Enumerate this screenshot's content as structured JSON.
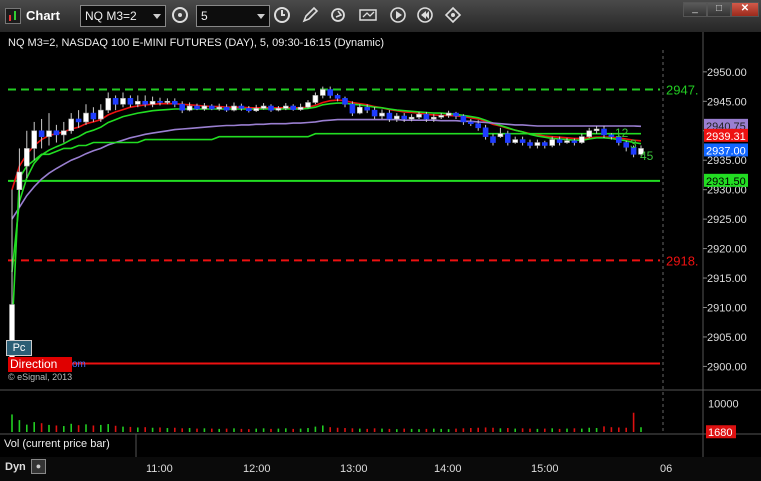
{
  "window": {
    "title": "Chart"
  },
  "toolbar": {
    "symbol": "NQ M3=2",
    "interval": "5",
    "icons": [
      "clock-icon",
      "clock-icon",
      "pencil-icon",
      "refresh-icon",
      "chart-style-icon",
      "play-icon",
      "rewind-icon",
      "cursor-icon"
    ]
  },
  "window_controls": {
    "minimize": "_",
    "maximize": "□",
    "close": "✕"
  },
  "chart_title": "NQ M3=2, NASDAQ 100 E-MINI FUTURES (DAY), 5, 09:30-16:15 (Dynamic)",
  "watermark": "© eSignal, 2013",
  "pc_label": "Pc",
  "direction_label": "Direction",
  "direction_extra": "om",
  "vol_label": "Vol (current price bar)",
  "bottom": {
    "dyn": "Dyn",
    "dyn_icon": "lock-icon"
  },
  "price_boxes": [
    {
      "label": "2947.",
      "color": "#22cc22"
    },
    {
      "label": "2940.75",
      "color": "#9a7fd1"
    },
    {
      "label": "2939.31",
      "color": "#ee1111"
    },
    {
      "label": "2937.00",
      "color": "#1166ff"
    },
    {
      "label": "2931.50",
      "color": "#22dd22"
    },
    {
      "label": "2918.",
      "color": "#ee1111"
    },
    {
      "label": "1680",
      "color": "#dd1111"
    }
  ],
  "counts": [
    "12",
    "3",
    "45"
  ],
  "chart_data": {
    "type": "candlestick",
    "x_ticks": [
      "11:00",
      "12:00",
      "13:00",
      "14:00",
      "15:00",
      "06"
    ],
    "y_ticks": [
      "2950.00",
      "2945.00",
      "2940.00",
      "2935.00",
      "2930.00",
      "2925.00",
      "2920.00",
      "2915.00",
      "2910.00",
      "2905.00",
      "2900.00"
    ],
    "ylim": [
      2898.2,
      2953.2
    ],
    "volume_ticks": [
      "10000"
    ],
    "volume_ylim": [
      0,
      12000
    ],
    "horizontal_lines": [
      {
        "price": 2947.0,
        "color": "#22cc22",
        "style": "dashed"
      },
      {
        "price": 2931.5,
        "color": "#22dd22",
        "style": "solid"
      },
      {
        "price": 2918.0,
        "color": "#ee1111",
        "style": "dashed"
      },
      {
        "price": 2900.5,
        "color": "#ee1111",
        "style": "solid"
      }
    ],
    "candles": [
      [
        2900,
        2910.5,
        2900,
        2930
      ],
      [
        2930,
        2933,
        2927,
        2937
      ],
      [
        2934,
        2937,
        2932,
        2940
      ],
      [
        2937,
        2940,
        2935,
        2941.5
      ],
      [
        2940,
        2939,
        2937,
        2942
      ],
      [
        2939,
        2940,
        2937.5,
        2943
      ],
      [
        2940,
        2939.3,
        2938,
        2941
      ],
      [
        2939.3,
        2940,
        2938,
        2941.5
      ],
      [
        2940,
        2942,
        2939.5,
        2943
      ],
      [
        2942,
        2941.5,
        2940.5,
        2943.5
      ],
      [
        2941.5,
        2943,
        2941,
        2944.5
      ],
      [
        2943,
        2942,
        2941.5,
        2944
      ],
      [
        2942,
        2943.5,
        2941.5,
        2944.5
      ],
      [
        2943.5,
        2945.5,
        2943,
        2946.5
      ],
      [
        2945.5,
        2944.5,
        2943.5,
        2946
      ],
      [
        2944.5,
        2945.5,
        2944,
        2946.5
      ],
      [
        2945.5,
        2944.5,
        2944,
        2946
      ],
      [
        2944.5,
        2945,
        2944,
        2946
      ],
      [
        2945,
        2944.5,
        2944,
        2946
      ],
      [
        2944.5,
        2945,
        2944,
        2945.8
      ],
      [
        2945,
        2944.8,
        2944.3,
        2945.6
      ],
      [
        2944.8,
        2945,
        2944.5,
        2945.5
      ],
      [
        2945,
        2944.5,
        2944,
        2945.5
      ],
      [
        2944.5,
        2943.5,
        2943,
        2945
      ],
      [
        2943.5,
        2944.2,
        2943.3,
        2944.8
      ],
      [
        2944.2,
        2943.7,
        2943.5,
        2944.6
      ],
      [
        2943.7,
        2944.2,
        2943.4,
        2944.7
      ],
      [
        2944.2,
        2943.7,
        2943.5,
        2944.5
      ],
      [
        2943.7,
        2944,
        2943.4,
        2944.6
      ],
      [
        2944,
        2943.5,
        2943.2,
        2944.5
      ],
      [
        2943.5,
        2944.2,
        2943.3,
        2944.8
      ],
      [
        2944.2,
        2943.8,
        2943.4,
        2944.6
      ],
      [
        2943.8,
        2943.4,
        2943.1,
        2944.2
      ],
      [
        2943.4,
        2943.8,
        2943.2,
        2944.4
      ],
      [
        2943.8,
        2944.2,
        2943.6,
        2944.7
      ],
      [
        2944.2,
        2943.5,
        2943.2,
        2944.5
      ],
      [
        2943.5,
        2943.8,
        2943.3,
        2944.2
      ],
      [
        2943.8,
        2944.2,
        2943.5,
        2944.7
      ],
      [
        2944.2,
        2943.6,
        2943.4,
        2944.5
      ],
      [
        2943.6,
        2944,
        2943.4,
        2944.6
      ],
      [
        2944,
        2944.8,
        2943.8,
        2945.2
      ],
      [
        2944.8,
        2946,
        2944.5,
        2946.5
      ],
      [
        2946,
        2947,
        2945.5,
        2947.5
      ],
      [
        2947,
        2946,
        2945.5,
        2947.5
      ],
      [
        2946,
        2945.5,
        2945,
        2946.3
      ],
      [
        2945.5,
        2944.5,
        2944,
        2945.8
      ],
      [
        2944.5,
        2943,
        2942.5,
        2945
      ],
      [
        2943,
        2944,
        2942.8,
        2944.5
      ],
      [
        2944,
        2943.5,
        2943,
        2944.5
      ],
      [
        2943.5,
        2942.5,
        2942,
        2944
      ],
      [
        2942.5,
        2943,
        2942,
        2943.6
      ],
      [
        2943,
        2942,
        2941.5,
        2943.5
      ],
      [
        2942,
        2942.5,
        2941.5,
        2943
      ],
      [
        2942.5,
        2942,
        2941.5,
        2943
      ],
      [
        2942,
        2942.3,
        2941.6,
        2942.8
      ],
      [
        2942.3,
        2942.8,
        2942,
        2943.2
      ],
      [
        2942.8,
        2942,
        2941.5,
        2943.2
      ],
      [
        2942,
        2942.3,
        2941.5,
        2942.8
      ],
      [
        2942.3,
        2942.6,
        2942,
        2943
      ],
      [
        2942.6,
        2943,
        2942.2,
        2943.4
      ],
      [
        2943,
        2942.5,
        2942,
        2943.2
      ],
      [
        2942.5,
        2941.5,
        2941,
        2942.8
      ],
      [
        2941.5,
        2941.2,
        2940.8,
        2942
      ],
      [
        2941.2,
        2940.5,
        2940,
        2941.8
      ],
      [
        2940.5,
        2939,
        2938.5,
        2941
      ],
      [
        2939,
        2938,
        2937.5,
        2939.5
      ],
      [
        2939,
        2939.5,
        2938.8,
        2940.5
      ],
      [
        2939.5,
        2938,
        2937.5,
        2940
      ],
      [
        2938,
        2938.5,
        2937.8,
        2939
      ],
      [
        2938.5,
        2938,
        2937.5,
        2939
      ],
      [
        2938,
        2937.5,
        2937,
        2938.5
      ],
      [
        2937.5,
        2938,
        2937,
        2938.5
      ],
      [
        2938,
        2937.5,
        2937,
        2938.3
      ],
      [
        2937.5,
        2938.5,
        2937.2,
        2939
      ],
      [
        2938.5,
        2938,
        2937.5,
        2939
      ],
      [
        2938,
        2938.3,
        2937.8,
        2938.8
      ],
      [
        2938.3,
        2938,
        2937.5,
        2938.7
      ],
      [
        2938,
        2939,
        2937.8,
        2939.5
      ],
      [
        2939,
        2940,
        2938.8,
        2940.5
      ],
      [
        2940,
        2940.3,
        2939.5,
        2940.8
      ],
      [
        2940.3,
        2939.3,
        2938.8,
        2940.8
      ],
      [
        2939.3,
        2939,
        2938.5,
        2939.6
      ],
      [
        2939,
        2938,
        2937.5,
        2939.3
      ],
      [
        2938,
        2937.2,
        2936.5,
        2938.3
      ],
      [
        2937.2,
        2936,
        2935.5,
        2937.5
      ],
      [
        2936,
        2937,
        2935.8,
        2937.5
      ]
    ],
    "volumes": [
      6200,
      4200,
      2600,
      3500,
      3100,
      2500,
      2300,
      2100,
      2900,
      2400,
      2700,
      2300,
      2500,
      2800,
      2200,
      1900,
      1800,
      1600,
      1700,
      1500,
      1600,
      1400,
      1500,
      1300,
      1400,
      1200,
      1300,
      1200,
      1100,
      1200,
      1300,
      1100,
      1000,
      1200,
      1300,
      1100,
      1200,
      1300,
      1100,
      1200,
      1400,
      1900,
      2300,
      1700,
      1500,
      1400,
      1300,
      1200,
      1100,
      1300,
      1200,
      1100,
      1000,
      1200,
      1100,
      1000,
      1100,
      1200,
      1100,
      1000,
      1200,
      1300,
      1400,
      1500,
      1600,
      1500,
      1300,
      1400,
      1200,
      1300,
      1200,
      1100,
      1200,
      1300,
      1100,
      1200,
      1300,
      1200,
      1500,
      1400,
      2000,
      1700,
      1600,
      1500,
      6800,
      1680
    ],
    "indicators": [
      {
        "name": "",
        "color": "#ee1111",
        "values": [
          2930,
          2934,
          2936,
          2937.5,
          2938.5,
          2939.2,
          2939.5,
          2939.8,
          2940.3,
          2940.6,
          2941.2,
          2941.5,
          2941.9,
          2942.7,
          2943.2,
          2943.6,
          2944,
          2944.2,
          2944.4,
          2944.5,
          2944.6,
          2944.6,
          2944.6,
          2944.5,
          2944.4,
          2944.3,
          2944.2,
          2944.1,
          2944.1,
          2944,
          2944,
          2944,
          2943.9,
          2943.9,
          2943.9,
          2943.9,
          2943.9,
          2943.9,
          2943.9,
          2943.9,
          2944,
          2944.3,
          2944.8,
          2945.1,
          2945.2,
          2945.1,
          2944.8,
          2944.6,
          2944.4,
          2944.1,
          2943.9,
          2943.6,
          2943.4,
          2943.2,
          2943.1,
          2943,
          2942.8,
          2942.7,
          2942.6,
          2942.6,
          2942.5,
          2942.4,
          2942.2,
          2942,
          2941.6,
          2941.1,
          2940.8,
          2940.4,
          2940.1,
          2939.8,
          2939.5,
          2939.3,
          2939.1,
          2939,
          2938.9,
          2938.8,
          2938.7,
          2938.7,
          2938.8,
          2938.9,
          2938.9,
          2938.9,
          2938.8,
          2938.6,
          2938.4,
          2938.3
        ]
      },
      {
        "name": "",
        "color": "#22dd22",
        "values": [
          2916,
          2928,
          2932,
          2934.5,
          2935.9,
          2936.7,
          2937.3,
          2937.8,
          2938.5,
          2939,
          2939.7,
          2940.1,
          2940.6,
          2941.4,
          2941.9,
          2942.4,
          2942.7,
          2943,
          2943.2,
          2943.4,
          2943.5,
          2943.6,
          2943.7,
          2943.7,
          2943.7,
          2943.7,
          2943.7,
          2943.7,
          2943.7,
          2943.7,
          2943.7,
          2943.7,
          2943.7,
          2943.7,
          2943.7,
          2943.7,
          2943.7,
          2943.7,
          2943.7,
          2943.7,
          2943.8,
          2944,
          2944.4,
          2944.6,
          2944.7,
          2944.7,
          2944.5,
          2944.4,
          2944.2,
          2944,
          2943.9,
          2943.7,
          2943.5,
          2943.4,
          2943.3,
          2943.2,
          2943.1,
          2943,
          2943,
          2942.9,
          2942.8,
          2942.6,
          2942.4,
          2942.2,
          2941.8,
          2941.3,
          2940.9,
          2940.5,
          2940.1,
          2939.8,
          2939.4,
          2939.1,
          2938.9,
          2938.7,
          2938.6,
          2938.5,
          2938.4,
          2938.4,
          2938.6,
          2938.8,
          2938.8,
          2938.7,
          2938.5,
          2938.3,
          2938,
          2937.8
        ]
      },
      {
        "name": "",
        "color": "#9a7fd1",
        "values": [
          2925,
          2927,
          2929,
          2930.5,
          2931.8,
          2932.8,
          2933.6,
          2934.3,
          2935,
          2935.5,
          2936.1,
          2936.6,
          2937,
          2937.6,
          2938,
          2938.4,
          2938.8,
          2939.1,
          2939.4,
          2939.6,
          2939.8,
          2940,
          2940.2,
          2940.3,
          2940.4,
          2940.5,
          2940.6,
          2940.7,
          2940.8,
          2940.9,
          2940.9,
          2941,
          2941,
          2941.1,
          2941.1,
          2941.2,
          2941.2,
          2941.2,
          2941.3,
          2941.3,
          2941.4,
          2941.5,
          2941.7,
          2941.8,
          2941.9,
          2941.9,
          2941.9,
          2941.9,
          2941.9,
          2941.9,
          2941.9,
          2941.9,
          2941.9,
          2941.8,
          2941.8,
          2941.8,
          2941.8,
          2941.8,
          2941.7,
          2941.7,
          2941.7,
          2941.6,
          2941.6,
          2941.5,
          2941.4,
          2941.3,
          2941.2,
          2941.1,
          2941,
          2941,
          2940.9,
          2940.8,
          2940.8,
          2940.8,
          2940.8,
          2940.8,
          2940.8,
          2940.8,
          2940.8,
          2940.8,
          2940.8,
          2940.8,
          2940.8,
          2940.8,
          2940.8,
          2940.75
        ]
      },
      {
        "name": "",
        "color": "#22dd22",
        "values": [
          2906,
          2932,
          2934,
          2935,
          2936,
          2936,
          2936.5,
          2937,
          2937,
          2937.5,
          2937.5,
          2938,
          2938,
          2938,
          2938,
          2938,
          2938,
          2938,
          2938.5,
          2938.5,
          2938.5,
          2938.5,
          2938.5,
          2938.5,
          2938.5,
          2938.5,
          2938.5,
          2938.5,
          2939,
          2939,
          2939,
          2939,
          2939,
          2939,
          2939,
          2939,
          2939,
          2939,
          2939,
          2939,
          2939,
          2939.5,
          2939.5,
          2939.5,
          2939.5,
          2939.5,
          2939.5,
          2939.5,
          2939.5,
          2939.5,
          2939.5,
          2939.5,
          2939.5,
          2939.5,
          2939.5,
          2939.5,
          2939.5,
          2939.5,
          2939.5,
          2939.5,
          2939.5,
          2939.5,
          2939.5,
          2939.5,
          2939.5,
          2939.5,
          2939.5,
          2939.5,
          2939.5,
          2939.5,
          2939.5,
          2939.5,
          2939.5,
          2939.5,
          2939.5,
          2939.5,
          2939.5,
          2939.5,
          2939.5,
          2939.5,
          2939.5,
          2939.5,
          2939.5,
          2939.5,
          2939.5,
          2939.5
        ]
      }
    ]
  }
}
